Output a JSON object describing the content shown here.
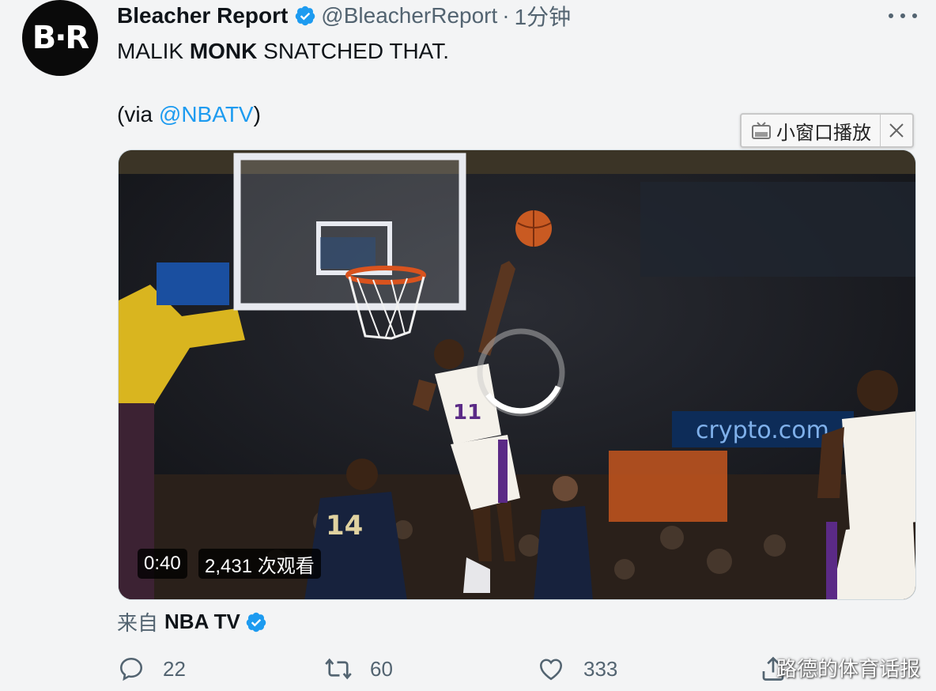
{
  "tweet": {
    "author_name": "Bleacher Report",
    "avatar_text": "B·R",
    "handle": "@BleacherReport",
    "separator": "·",
    "time": "1分钟",
    "text_part1": "MALIK ",
    "text_bold": "MONK",
    "text_part2": " SNATCHED THAT.",
    "via_open": "(via ",
    "via_mention": "@NBATV",
    "via_close": ")"
  },
  "pip": {
    "label": "小窗口播放"
  },
  "video": {
    "duration": "0:40",
    "views": "2,431 次观看"
  },
  "source": {
    "prefix": "来自",
    "name": "NBA TV"
  },
  "actions": {
    "replies": "22",
    "retweets": "60",
    "likes": "333"
  },
  "watermark": "路德的体育话报",
  "colors": {
    "accent": "#1d9bf0",
    "muted": "#536471"
  }
}
